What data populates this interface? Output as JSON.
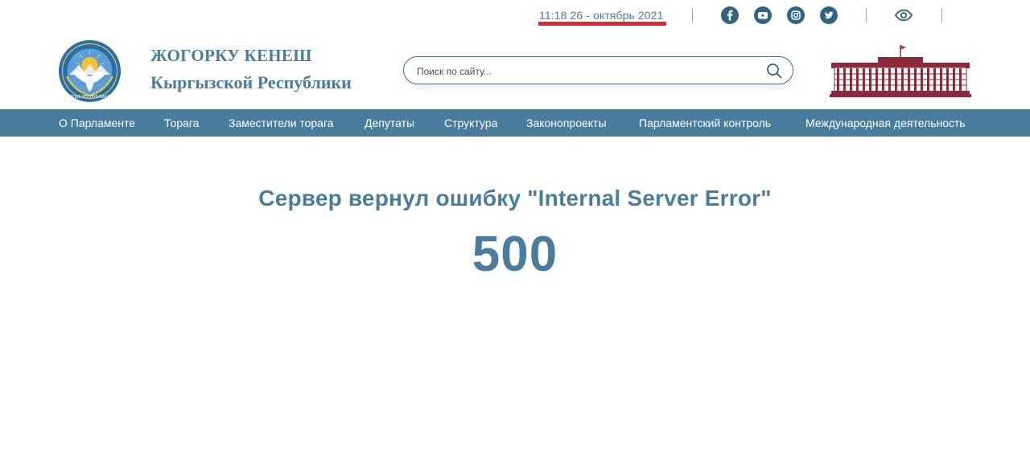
{
  "topbar": {
    "datetime": "11:18 26 - октябрь 2021",
    "social": [
      {
        "icon": "facebook-icon",
        "glyph": "f"
      },
      {
        "icon": "youtube-icon",
        "glyph": "play"
      },
      {
        "icon": "instagram-icon",
        "glyph": "camera"
      },
      {
        "icon": "twitter-icon",
        "glyph": "bird"
      }
    ],
    "accessibility_icon": "eye-icon"
  },
  "header": {
    "brand_line1": "ЖОГОРКУ КЕНЕШ",
    "brand_line2": "Кыргызской Республики",
    "search_placeholder": "Поиск по сайту..."
  },
  "nav": {
    "items": [
      "О Парламенте",
      "Торага",
      "Заместители торага",
      "Депутаты",
      "Структура",
      "Законопроекты",
      "Парламентский контроль",
      "Международная деятельность"
    ]
  },
  "error": {
    "message": "Сервер вернул ошибку \"Internal Server Error\"",
    "code": "500"
  },
  "colors": {
    "brand": "#4a7c9e",
    "accent_red": "#e3232d",
    "building": "#8a2a3a"
  }
}
